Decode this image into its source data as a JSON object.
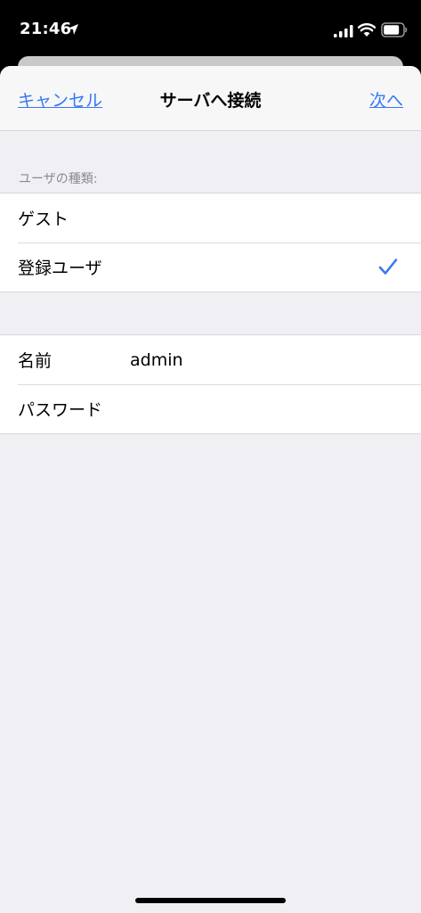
{
  "status_bar": {
    "time": "21:46"
  },
  "nav": {
    "cancel_label": "キャンセル",
    "title": "サーバへ接続",
    "next_label": "次へ"
  },
  "user_type": {
    "header": "ユーザの種類:",
    "options": [
      {
        "label": "ゲスト",
        "selected": false
      },
      {
        "label": "登録ユーザ",
        "selected": true
      }
    ]
  },
  "credentials": {
    "name_label": "名前",
    "name_value": "admin",
    "password_label": "パスワード",
    "password_value": ""
  },
  "colors": {
    "accent": "#3478f6",
    "background": "#efeff4"
  }
}
